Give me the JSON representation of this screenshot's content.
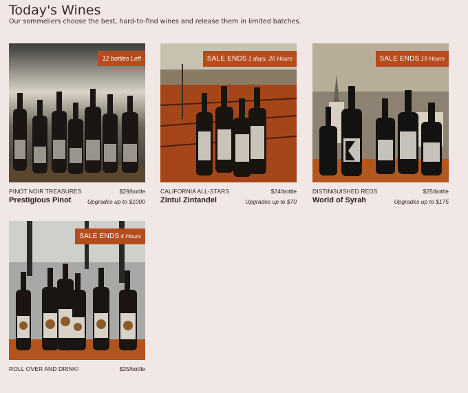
{
  "header": {
    "title": "Today's Wines",
    "subtitle": "Our sommeliers choose the best, hard-to-find wines and release them in limited batches."
  },
  "wines": [
    {
      "badge": "12 bottles Left",
      "badge_detail": "",
      "category": "PINOT NOIR TREASURES",
      "price": "$29/bottle",
      "name": "Prestigious Pinot",
      "upgrade": "Upgrades up to $1000"
    },
    {
      "badge": "SALE ENDS",
      "badge_detail": "1 days, 20 Hours",
      "category": "CALIFORNIA ALL-STARS",
      "price": "$24/bottle",
      "name": "Zintul Zintandel",
      "upgrade": "Upgrades up to $70"
    },
    {
      "badge": "SALE ENDS",
      "badge_detail": "19 Hours",
      "category": "DISTINGUISHED REDS",
      "price": "$25/bottle",
      "name": "World of Syrah",
      "upgrade": "Upgrades up to $175"
    },
    {
      "badge": "SALE ENDS",
      "badge_detail": "4 Hours",
      "category": "ROLL OVER AND DRINK!",
      "price": "$25/bottle",
      "name": "",
      "upgrade": ""
    }
  ],
  "colors": {
    "background": "#f1e7e5",
    "badge": "#b54c1e"
  }
}
